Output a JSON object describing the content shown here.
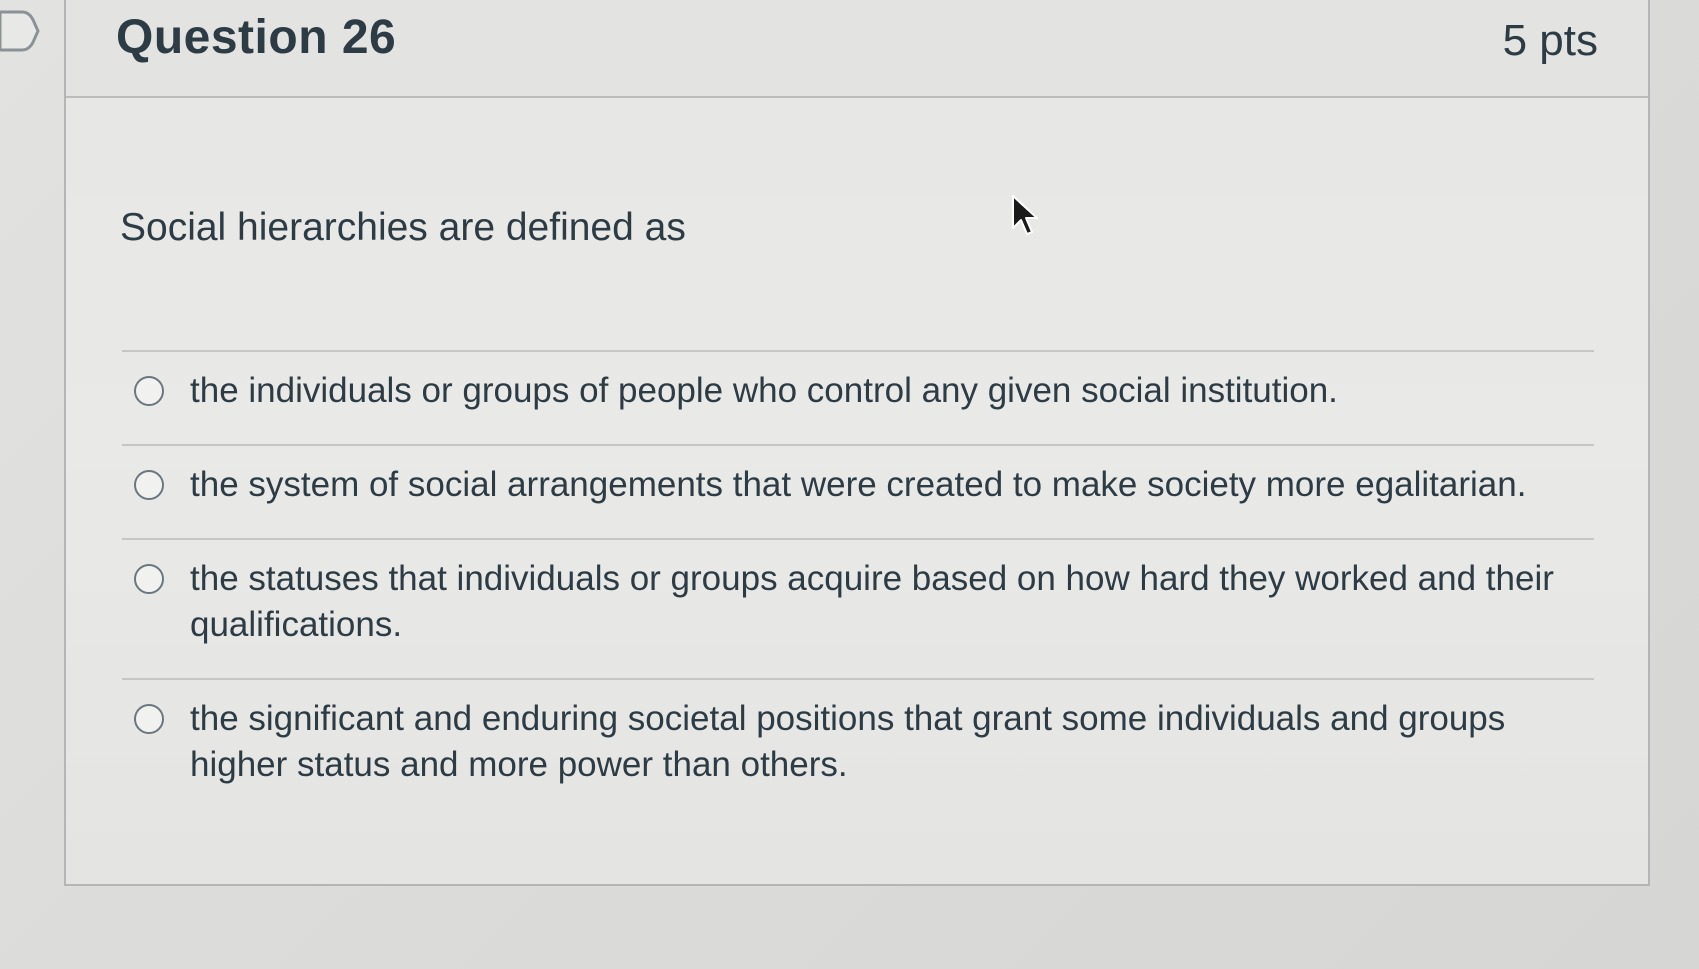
{
  "question": {
    "title": "Question 26",
    "points": "5 pts",
    "text": "Social hierarchies are defined as"
  },
  "answers": [
    {
      "label": "the individuals or groups of people who control any given social institution.",
      "selected": false
    },
    {
      "label": "the system of social arrangements that were created to make society more egalitarian.",
      "selected": false
    },
    {
      "label": "the statuses that individuals or groups acquire based on how hard they worked and their qualifications.",
      "selected": false
    },
    {
      "label": "the significant and enduring societal positions that grant some individuals and groups higher status and more power than others.",
      "selected": false
    }
  ],
  "icons": {
    "flag": "flag-icon",
    "cursor": "mouse-pointer-icon"
  },
  "colors": {
    "text": "#2d3b45",
    "border": "#b3b6b5",
    "radio_border": "#6b7780"
  }
}
